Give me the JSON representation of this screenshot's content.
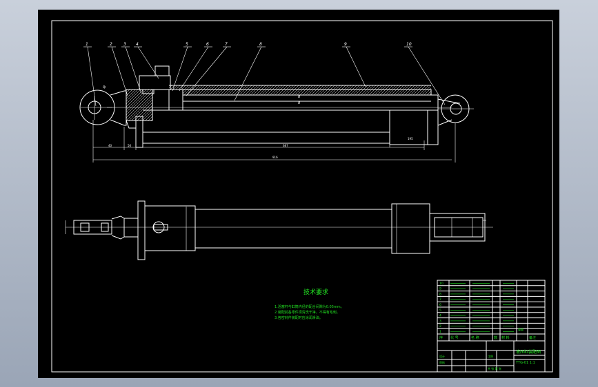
{
  "balloons": [
    "1",
    "2",
    "3",
    "4",
    "5",
    "6",
    "7",
    "8",
    "9",
    "10"
  ],
  "dims": {
    "d1": "40",
    "d2": "50",
    "d3": "687",
    "d4": "195",
    "d5": "916",
    "d6": "Ø",
    "d7": "Ø",
    "d8": "Ø"
  },
  "tech": {
    "title": "技术要求",
    "lines": [
      "1.活塞杆与缸筒内径的配合间隙为0.05mm。",
      "2.装配前各零件须清洗干净，不得有毛刺。",
      "3.各密封件装配时应涂润滑油。"
    ]
  },
  "parts": [
    {
      "no": "10",
      "code": "",
      "name": "",
      "qty": "",
      "mat": ""
    },
    {
      "no": "9",
      "code": "",
      "name": "",
      "qty": "",
      "mat": ""
    },
    {
      "no": "8",
      "code": "",
      "name": "",
      "qty": "",
      "mat": ""
    },
    {
      "no": "7",
      "code": "",
      "name": "",
      "qty": "",
      "mat": ""
    },
    {
      "no": "6",
      "code": "",
      "name": "",
      "qty": "",
      "mat": ""
    },
    {
      "no": "5",
      "code": "",
      "name": "",
      "qty": "",
      "mat": ""
    },
    {
      "no": "4",
      "code": "",
      "name": "",
      "qty": "",
      "mat": ""
    },
    {
      "no": "3",
      "code": "",
      "name": "",
      "qty": "",
      "mat": ""
    },
    {
      "no": "2",
      "code": "",
      "name": "",
      "qty": "",
      "mat": ""
    },
    {
      "no": "1",
      "code": "",
      "name": "",
      "qty": "",
      "mat": ""
    }
  ],
  "titleblock": {
    "hdr_no": "序",
    "hdr_code": "代  号",
    "hdr_name": "名  称",
    "hdr_qty": "数",
    "hdr_mat": "材 料",
    "hdr_wt": "重量",
    "hdr_note": "备注",
    "school": "",
    "drawing_name": "液压缸装配图",
    "project": "",
    "designer": "设计",
    "checker": "审核",
    "scale": "比例",
    "sheet": "共 张 第 张",
    "drawing_no": "YYG-01  1:1"
  },
  "colors": {
    "drawing": "#ffffff",
    "text": "#22e022",
    "sheet": "#000000"
  }
}
